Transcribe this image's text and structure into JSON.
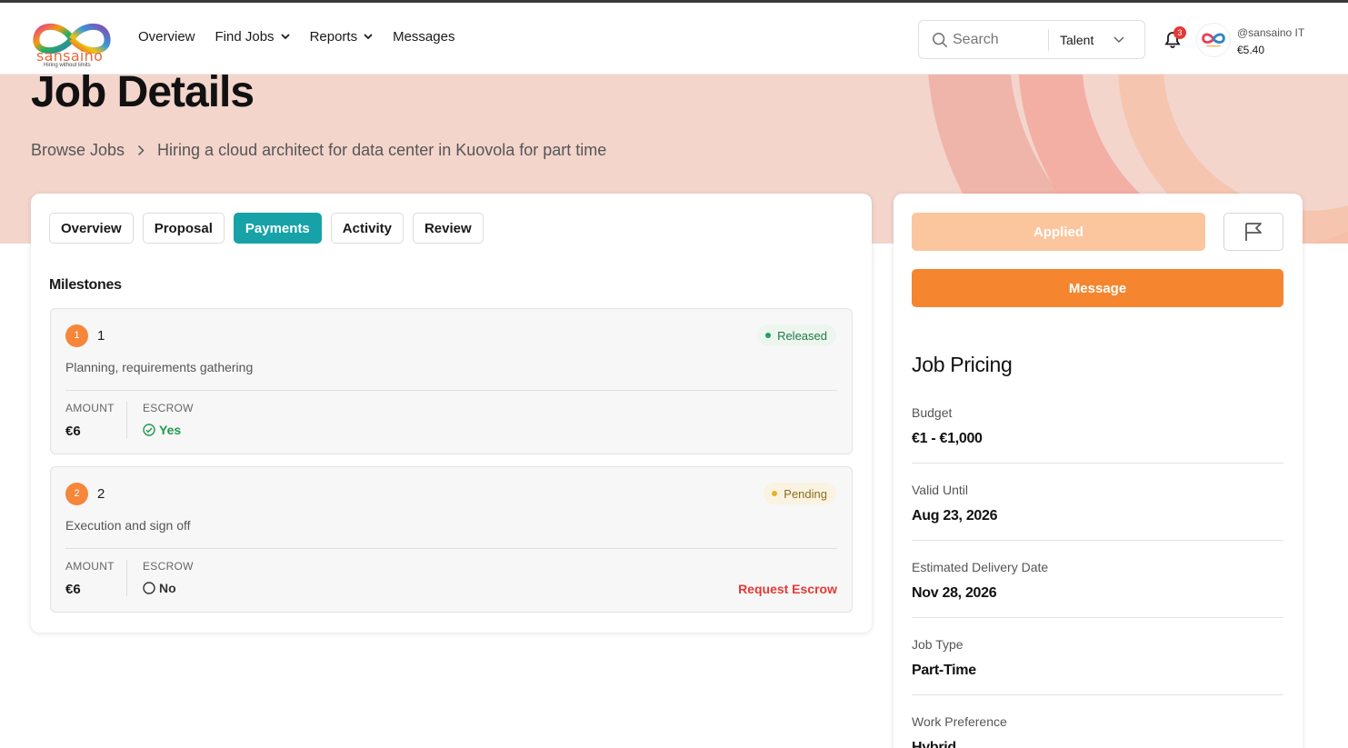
{
  "brand": {
    "name": "sansaino",
    "tagline": "Hiring without limits"
  },
  "nav": [
    {
      "label": "Overview",
      "has_dropdown": false
    },
    {
      "label": "Find Jobs",
      "has_dropdown": true
    },
    {
      "label": "Reports",
      "has_dropdown": true
    },
    {
      "label": "Messages",
      "has_dropdown": false
    }
  ],
  "search": {
    "placeholder": "Search",
    "role": "Talent"
  },
  "notifications": {
    "count": "3"
  },
  "user": {
    "handle": "@sansaino IT",
    "balance": "€5.40"
  },
  "page": {
    "title": "Job Details",
    "breadcrumb": {
      "root": "Browse Jobs",
      "current": "Hiring a cloud architect for data center in Kuovola for part time"
    }
  },
  "tabs": [
    {
      "label": "Overview",
      "active": false
    },
    {
      "label": "Proposal",
      "active": false
    },
    {
      "label": "Payments",
      "active": true
    },
    {
      "label": "Activity",
      "active": false
    },
    {
      "label": "Review",
      "active": false
    }
  ],
  "milestones": {
    "title": "Milestones",
    "amount_label": "AMOUNT",
    "escrow_label": "ESCROW",
    "items": [
      {
        "number": "1",
        "title": "1",
        "status": "Released",
        "description": "Planning, requirements gathering",
        "amount": "€6",
        "escrow": "Yes",
        "action": ""
      },
      {
        "number": "2",
        "title": "2",
        "status": "Pending",
        "description": "Execution and sign off",
        "amount": "€6",
        "escrow": "No",
        "action": "Request Escrow"
      }
    ]
  },
  "sidebar": {
    "applied_label": "Applied",
    "message_label": "Message",
    "pricing_title": "Job Pricing",
    "rows": [
      {
        "label": "Budget",
        "value": "€1 - €1,000"
      },
      {
        "label": "Valid Until",
        "value": "Aug 23, 2026"
      },
      {
        "label": "Estimated Delivery Date",
        "value": "Nov 28, 2026"
      },
      {
        "label": "Job Type",
        "value": "Part-Time"
      },
      {
        "label": "Work Preference",
        "value": "Hybrid"
      }
    ]
  },
  "colors": {
    "accent_teal": "#17a2a8",
    "accent_orange": "#f5862f",
    "applied_orange": "#fbc69d",
    "danger": "#e53935",
    "success": "#1f9a4c",
    "hero_bg": "#f3d5cc"
  }
}
